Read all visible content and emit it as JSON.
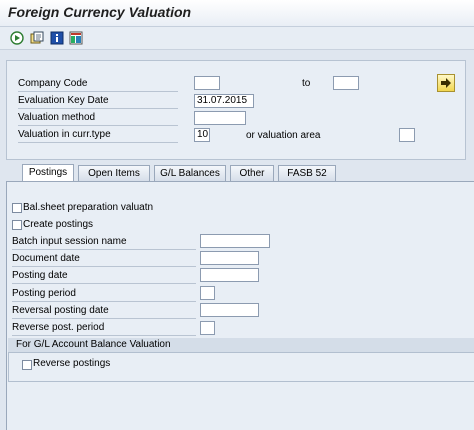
{
  "header": {
    "title": "Foreign Currency Valuation"
  },
  "toolbar": {
    "icons": [
      "execute-icon",
      "variant-icon",
      "info-icon",
      "layout-icon"
    ]
  },
  "selection": {
    "company_code": {
      "label": "Company Code",
      "value": "",
      "to_label": "to",
      "to_value": ""
    },
    "evaluation_key_date": {
      "label": "Evaluation Key Date",
      "value": "31.07.2015"
    },
    "valuation_method": {
      "label": "Valuation method",
      "value": ""
    },
    "valuation_curr_type": {
      "label": "Valuation in curr.type",
      "value": "10",
      "area_label": "or valuation area",
      "area_value": ""
    }
  },
  "tabs": [
    {
      "label": "Postings",
      "active": true
    },
    {
      "label": "Open Items",
      "active": false
    },
    {
      "label": "G/L Balances",
      "active": false
    },
    {
      "label": "Other",
      "active": false
    },
    {
      "label": "FASB 52",
      "active": false
    }
  ],
  "postings": {
    "balsheet_prep": {
      "label": "Bal.sheet preparation valuatn",
      "checked": false
    },
    "create_postings": {
      "label": "Create postings",
      "checked": false
    },
    "batch_session_name": {
      "label": "Batch input session name",
      "value": ""
    },
    "document_date": {
      "label": "Document date",
      "value": ""
    },
    "posting_date": {
      "label": "Posting date",
      "value": ""
    },
    "posting_period": {
      "label": "Posting period",
      "value": ""
    },
    "reversal_posting_date": {
      "label": "Reversal posting date",
      "value": ""
    },
    "reverse_post_period": {
      "label": "Reverse post. period",
      "value": ""
    },
    "gl_group": {
      "title": "For G/L Account Balance Valuation",
      "reverse_postings": {
        "label": "Reverse postings",
        "checked": false
      }
    }
  },
  "colors": {
    "background": "#dfe6ef",
    "panel": "#e8eef5",
    "execute": "#f2d64e"
  }
}
